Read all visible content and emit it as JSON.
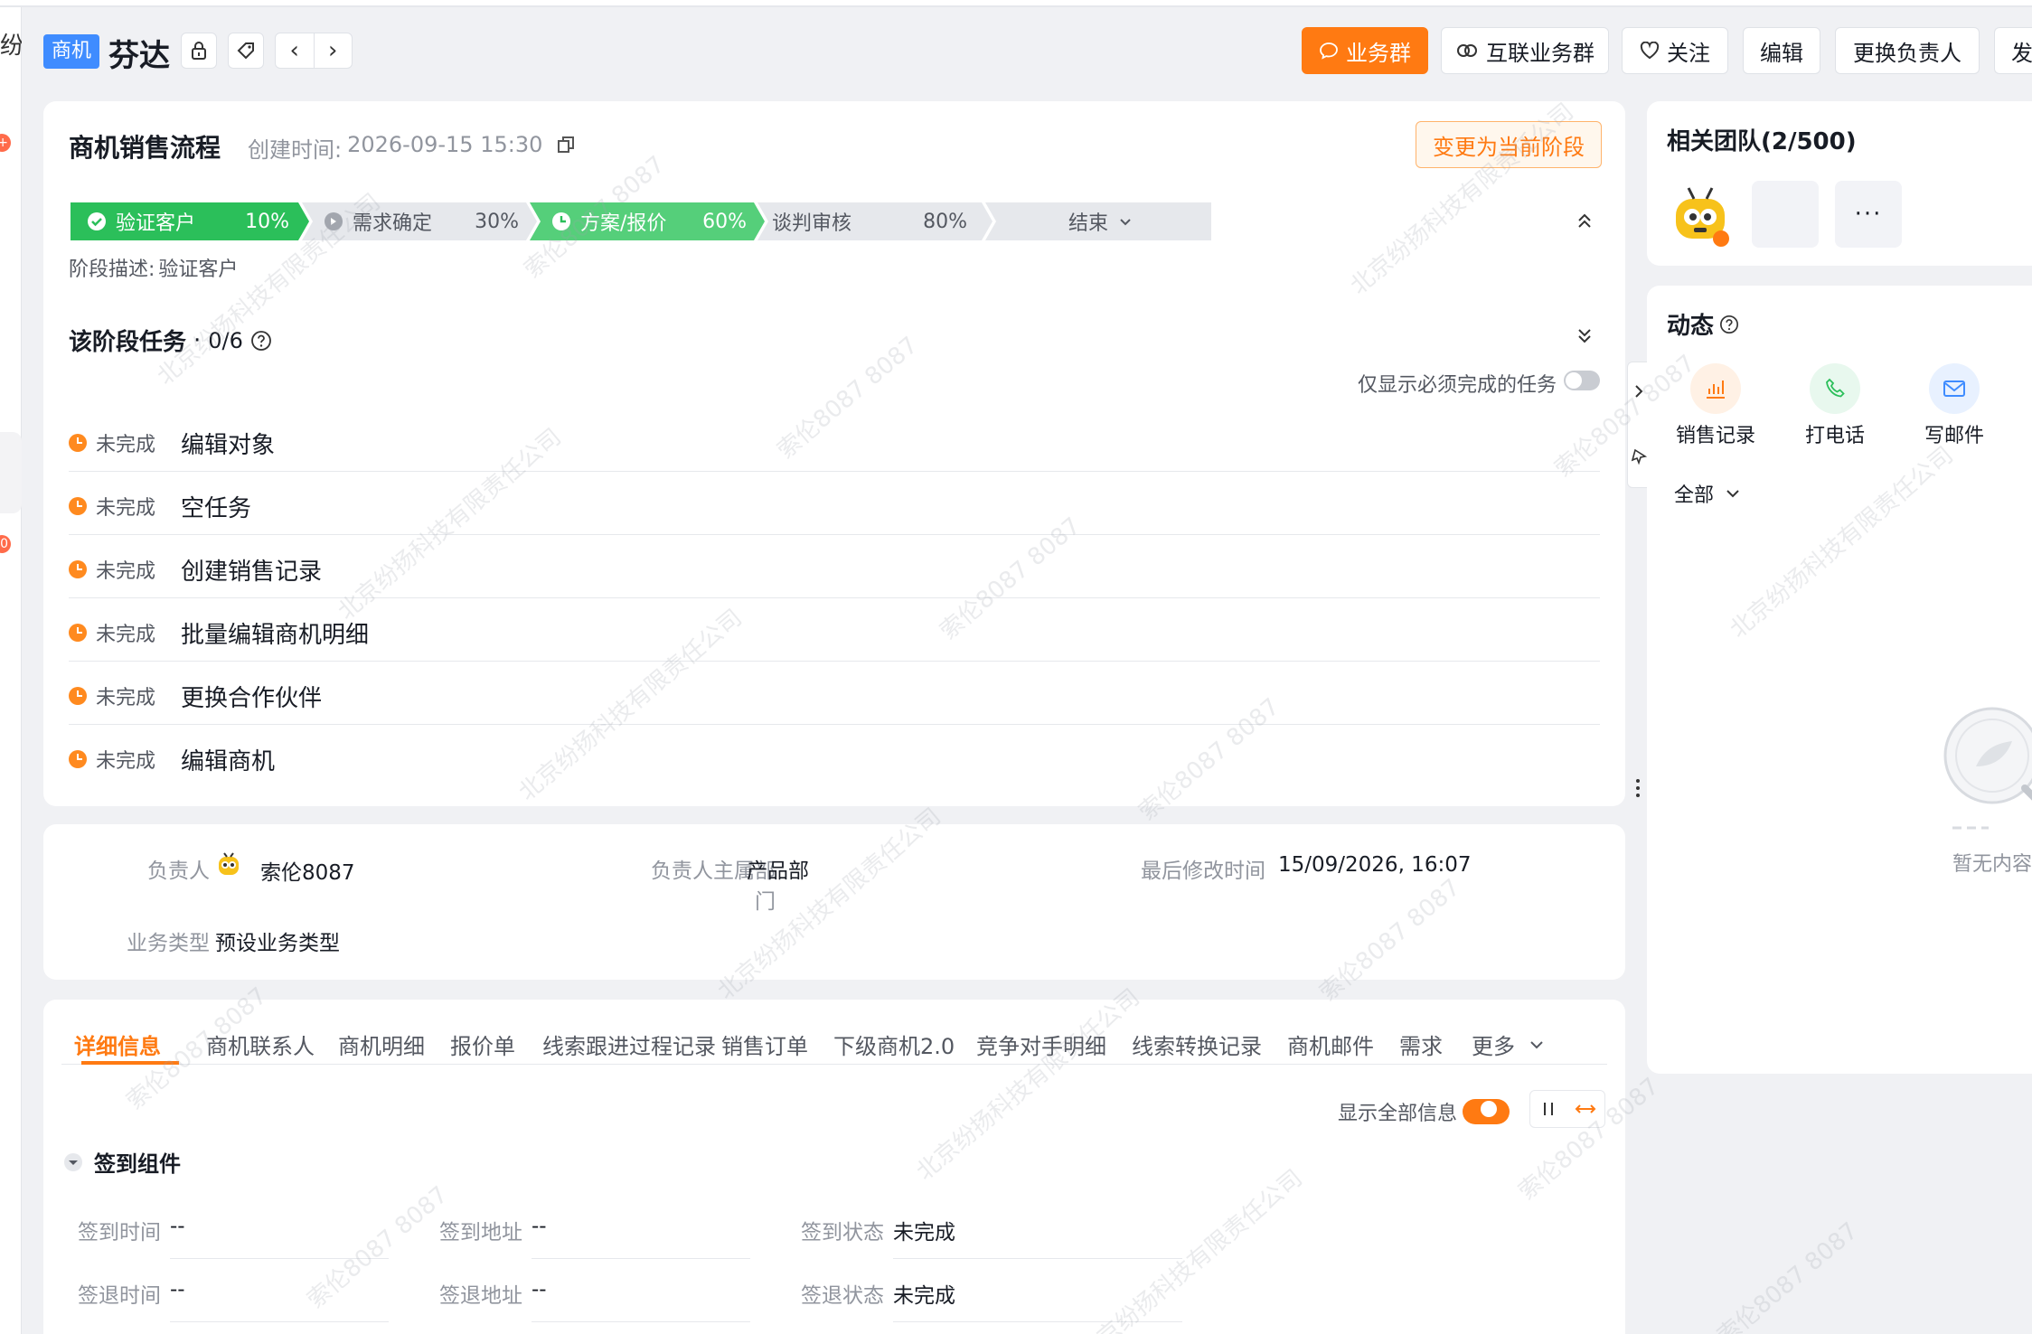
{
  "left_rail": {
    "cut_text": "纷扬",
    "badge": "+",
    "badge2": "0"
  },
  "header": {
    "tag": "商机",
    "title": "芬达",
    "buttons": {
      "biz_group": "业务群",
      "linked_group": "互联业务群",
      "follow": "关注",
      "edit": "编辑",
      "change_owner": "更换负责人",
      "more_cut": "发起"
    }
  },
  "process": {
    "title": "商机销售流程",
    "created_label": "创建时间:",
    "created_value": "2026-09-15 15:30",
    "change_stage_button": "变更为当前阶段",
    "stages": [
      {
        "name": "验证客户",
        "percent": "10%",
        "state": "done"
      },
      {
        "name": "需求确定",
        "percent": "30%",
        "state": "skipped"
      },
      {
        "name": "方案/报价",
        "percent": "60%",
        "state": "current"
      },
      {
        "name": "谈判审核",
        "percent": "80%",
        "state": "pending"
      },
      {
        "name": "结束",
        "percent": "",
        "state": "pending"
      }
    ],
    "stage_desc_label": "阶段描述:",
    "stage_desc_value": "验证客户"
  },
  "tasks": {
    "title": "该阶段任务",
    "count": "0/6",
    "filter_label": "仅显示必须完成的任务",
    "status_label": "未完成",
    "items": [
      "编辑对象",
      "空任务",
      "创建销售记录",
      "批量编辑商机明细",
      "更换合作伙伴",
      "编辑商机"
    ]
  },
  "summary": {
    "owner_label": "负责人",
    "owner_value": "索伦8087",
    "dept_label": "负责人主属部门",
    "dept_value": "产品部",
    "modified_label": "最后修改时间",
    "modified_value": "15/09/2026, 16:07",
    "biztype_label": "业务类型",
    "biztype_value": "预设业务类型"
  },
  "detail_tabs": {
    "tabs": [
      "详细信息",
      "商机联系人",
      "商机明细",
      "报价单",
      "线索跟进过程记录",
      "销售订单",
      "下级商机2.0",
      "竞争对手明细",
      "线索转换记录",
      "商机邮件",
      "需求",
      "更多"
    ],
    "show_all_label": "显示全部信息",
    "section_title": "签到组件",
    "fields": [
      {
        "label": "签到时间",
        "value": "--"
      },
      {
        "label": "签到地址",
        "value": "--"
      },
      {
        "label": "签到状态",
        "value": "未完成"
      },
      {
        "label": "签退时间",
        "value": "--"
      },
      {
        "label": "签退地址",
        "value": "--"
      },
      {
        "label": "签退状态",
        "value": "未完成"
      }
    ]
  },
  "team": {
    "title": "相关团队(2/500)"
  },
  "activity": {
    "title": "动态",
    "actions": [
      "销售记录",
      "打电话",
      "写邮件"
    ],
    "filter": "全部",
    "empty_text": "暂无内容"
  },
  "watermark": {
    "company": "北京纷扬科技有限责任公司",
    "user": "索伦8087 8087"
  },
  "colors": {
    "accent": "#ff7a12",
    "done_green": "#2bbf5a",
    "tag_blue": "#3f8cff"
  }
}
